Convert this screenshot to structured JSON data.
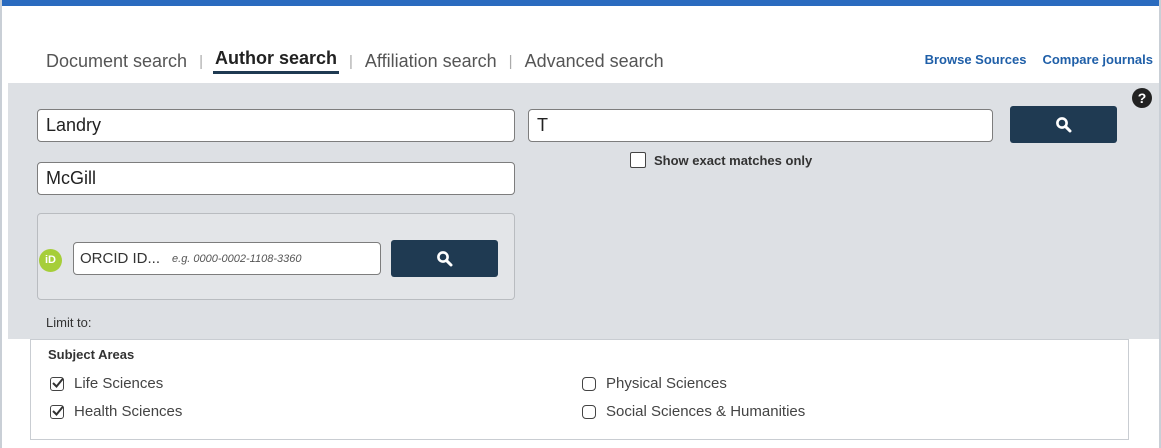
{
  "tabs": [
    {
      "label": "Document search",
      "active": false
    },
    {
      "label": "Author search",
      "active": true
    },
    {
      "label": "Affiliation search",
      "active": false
    },
    {
      "label": "Advanced search",
      "active": false
    }
  ],
  "tab_separator": "|",
  "links": {
    "browse": "Browse Sources",
    "compare": "Compare journals"
  },
  "help_icon": "?",
  "form": {
    "last_name": "Landry",
    "first_name": "T",
    "affiliation": "McGill",
    "exact_matches_label": "Show exact matches only",
    "exact_matches_checked": false
  },
  "orcid": {
    "badge": "iD",
    "placeholder": "ORCID ID...",
    "example": "e.g. 0000-0002-1108-3360"
  },
  "limit_label": "Limit to:",
  "subject_areas": {
    "title": "Subject Areas",
    "items": [
      {
        "label": "Life Sciences",
        "checked": true
      },
      {
        "label": "Health Sciences",
        "checked": true
      },
      {
        "label": "Physical Sciences",
        "checked": false
      },
      {
        "label": "Social Sciences & Humanities",
        "checked": false
      }
    ]
  },
  "colors": {
    "primary_button": "#1f3a52",
    "panel": "#dde0e4",
    "link": "#1f5fa8",
    "orcid_green": "#a6ce39"
  }
}
